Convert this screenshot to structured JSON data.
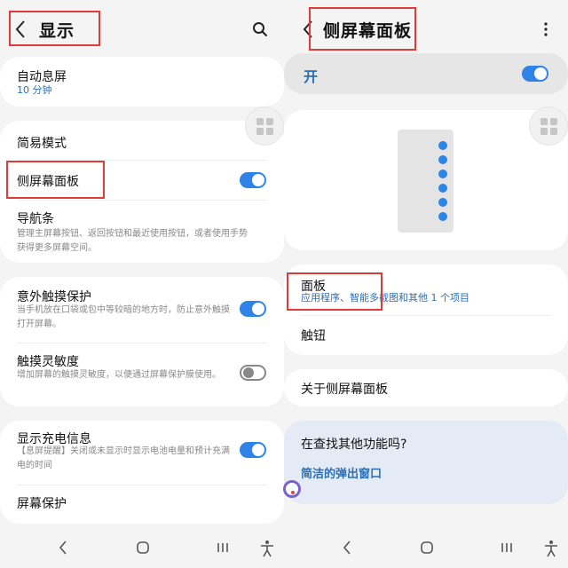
{
  "left": {
    "title": "显示",
    "auto_screen_off": {
      "title": "自动息屏",
      "value": "10 分钟"
    },
    "easy_mode": {
      "title": "简易模式"
    },
    "edge_panels": {
      "title": "侧屏幕面板",
      "toggle": "on"
    },
    "nav_bar": {
      "title": "导航条",
      "sub": "管理主屏幕按钮、返回按钮和最近使用按钮，或者使用手势获得更多屏幕空间。"
    },
    "accidental_touch": {
      "title": "意外触摸保护",
      "sub": "当手机放在口袋或包中等较暗的地方时，防止意外触摸打开屏幕。",
      "toggle": "on"
    },
    "touch_sensitivity": {
      "title": "触摸灵敏度",
      "sub": "增加屏幕的触摸灵敏度，以便通过屏幕保护膜使用。",
      "toggle": "off"
    },
    "charging_info": {
      "title": "显示充电信息",
      "sub": "【息屏提醒】关闭或未显示时显示电池电量和预计充满电的时间",
      "toggle": "on"
    },
    "screensaver": {
      "title": "屏幕保护"
    }
  },
  "right": {
    "title": "侧屏幕面板",
    "master": {
      "label": "开",
      "toggle": "on"
    },
    "panels": {
      "title": "面板",
      "sub": "应用程序、智能多截图和其他 1 个项目"
    },
    "handle": {
      "title": "触钮"
    },
    "about": {
      "title": "关于侧屏幕面板"
    },
    "looking": {
      "title": "在查找其他功能吗?",
      "link": "简洁的弹出窗口"
    }
  },
  "colors": {
    "accent": "#2f82e6",
    "highlight_box": "#e03a3a",
    "link": "#2a6fb5"
  }
}
